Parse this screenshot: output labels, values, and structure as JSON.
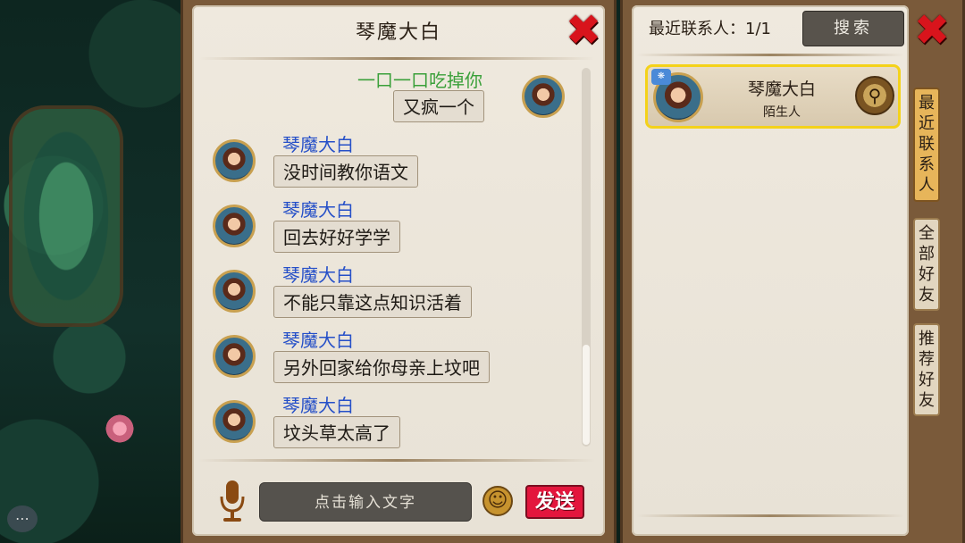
{
  "chat": {
    "title": "琴魔大白",
    "messages": [
      {
        "sender": "一口一口吃掉你",
        "text": "又疯一个",
        "self": true
      },
      {
        "sender": "琴魔大白",
        "text": "没时间教你语文",
        "self": false
      },
      {
        "sender": "琴魔大白",
        "text": "回去好好学学",
        "self": false
      },
      {
        "sender": "琴魔大白",
        "text": "不能只靠这点知识活着",
        "self": false
      },
      {
        "sender": "琴魔大白",
        "text": "另外回家给你母亲上坟吧",
        "self": false
      },
      {
        "sender": "琴魔大白",
        "text": "坟头草太高了",
        "self": false
      }
    ],
    "input_placeholder": "点击输入文字",
    "send_label": "发送"
  },
  "contacts": {
    "header": "最近联系人：1/1",
    "search_label": "搜索",
    "items": [
      {
        "name": "琴魔大白",
        "relation": "陌生人"
      }
    ],
    "tabs": [
      {
        "label": "最近联系人",
        "active": true
      },
      {
        "label": "全部好友",
        "active": false
      },
      {
        "label": "推荐好友",
        "active": false
      }
    ]
  },
  "icons": {
    "close": "close-icon",
    "mic": "microphone-icon",
    "emoji": "smiley-icon",
    "search": "magnifier-icon",
    "chat_bubble": "chat-bubble-icon"
  },
  "colors": {
    "self_name": "#3aa03a",
    "other_name": "#2650c8",
    "send_button": "#e3163d",
    "highlight": "#f4d21a",
    "close": "#d8141c"
  }
}
